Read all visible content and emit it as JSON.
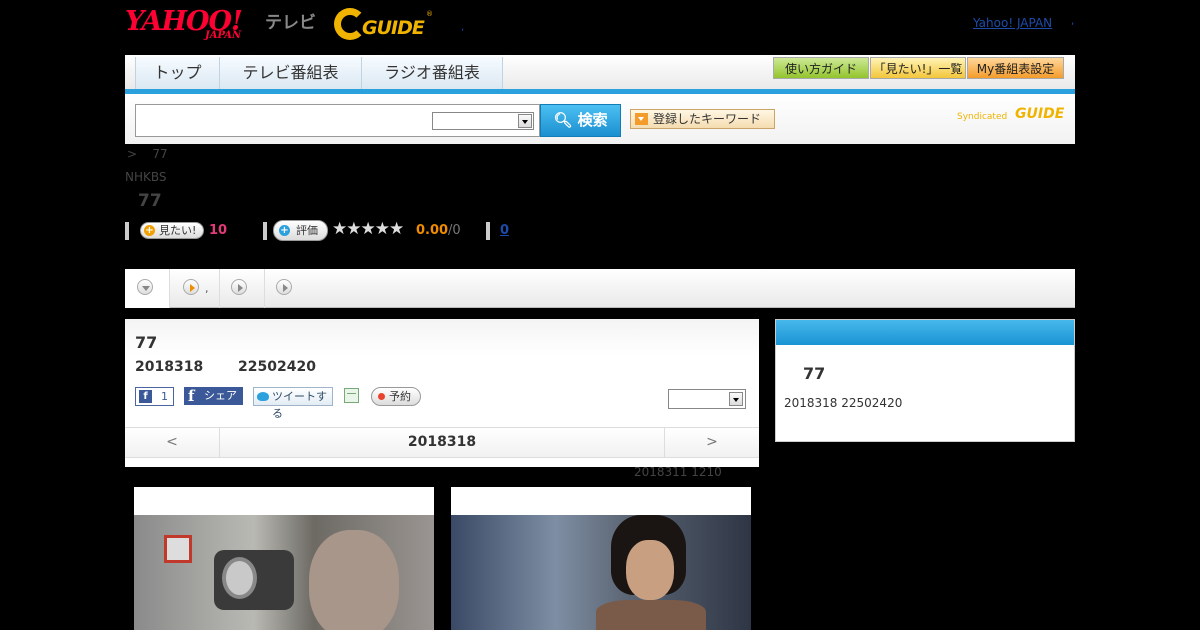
{
  "header": {
    "yahoo_logo": "YAHOO!",
    "yahoo_japan": "JAPAN",
    "tv_label": "テレビ",
    "gguide_logo": "GUIDE",
    "registered": "®",
    "dot_left": ",",
    "yahoo_japan_link": "Yahoo! JAPAN",
    "dot_right": ","
  },
  "nav": {
    "tabs": [
      {
        "label": "トップ"
      },
      {
        "label": "テレビ番組表"
      },
      {
        "label": "ラジオ番組表"
      }
    ],
    "buttons": [
      {
        "label": "使い方ガイド",
        "color": "#93c42d"
      },
      {
        "label": "「見たい!」一覧",
        "color": "#f3c63a"
      },
      {
        "label": "My番組表設定",
        "color": "#f39b2b"
      }
    ],
    "accent_color": "#2aa0dc"
  },
  "search": {
    "placeholder": "",
    "select_value": "",
    "button_label": "検索",
    "keyword_button_label": "登録したキーワード",
    "syndicated_label": "Syndicated",
    "syndicated_logo": "GUIDE"
  },
  "breadcrumb": {
    "separator": ">",
    "current": "77"
  },
  "program": {
    "channel": "NHKBS",
    "title": "77",
    "mitai_label": "見たい!",
    "mitai_count": "10",
    "rating_label": "評価",
    "stars": "★★★★★",
    "score": "0.00",
    "score_den": "/0",
    "review_count": "0"
  },
  "subtabs": {
    "dot": ","
  },
  "main_panel": {
    "title": "77",
    "date": "2018318",
    "time": "22502420",
    "fb_like_icon": "f",
    "fb_like_count": "1",
    "fb_share_label": "シェア",
    "tweet_label": "ツイートする",
    "reserve_label": "予約",
    "select_value": "",
    "date_nav": {
      "prev": "<",
      "current": "2018318",
      "next": ">"
    },
    "updated": "2018311  1210"
  },
  "side_panel": {
    "title": "77",
    "info": "2018318  22502420",
    "header_color": "#2aa0dc"
  }
}
